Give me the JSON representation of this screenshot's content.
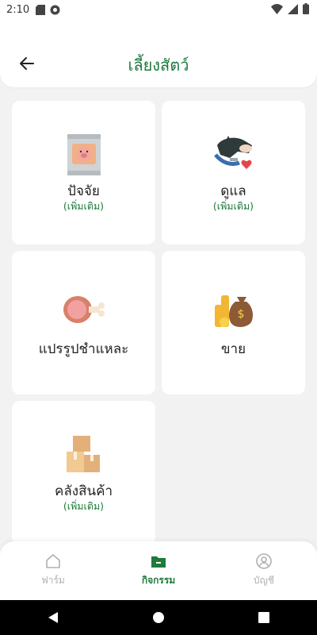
{
  "status_bar": {
    "time": "2:10"
  },
  "header": {
    "title": "เลี้ยงสัตว์"
  },
  "cards": [
    {
      "label": "ปัจจัย",
      "sub": "(เพิ่มเติม)",
      "icon": "feed-bag-icon"
    },
    {
      "label": "ดูแล",
      "sub": "(เพิ่มเติม)",
      "icon": "animal-care-icon"
    },
    {
      "label": "แปรรูปชำแหละ",
      "sub": "",
      "icon": "meat-leg-icon"
    },
    {
      "label": "ขาย",
      "sub": "",
      "icon": "money-bag-icon"
    },
    {
      "label": "คลังสินค้า",
      "sub": "(เพิ่มเติม)",
      "icon": "warehouse-boxes-icon"
    }
  ],
  "bottom_nav": {
    "items": [
      {
        "label": "ฟาร์ม",
        "icon": "home-icon",
        "active": false
      },
      {
        "label": "กิจกรรม",
        "icon": "folder-icon",
        "active": true
      },
      {
        "label": "บัญชี",
        "icon": "user-icon",
        "active": false
      }
    ]
  },
  "colors": {
    "accent": "#1e7a3d",
    "background": "#f2f2f2",
    "card": "#ffffff",
    "inactive": "#b0b0b0"
  }
}
